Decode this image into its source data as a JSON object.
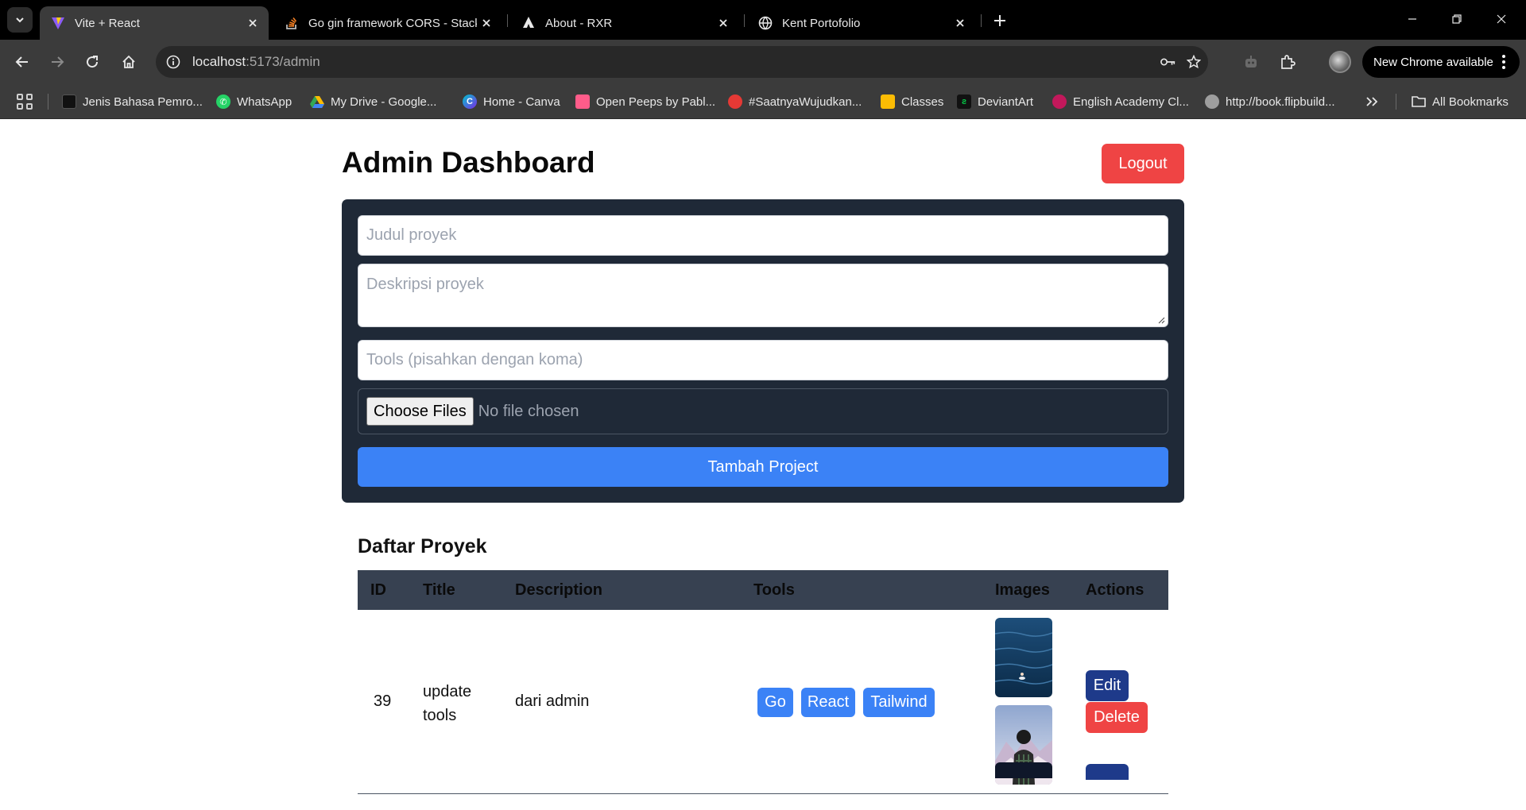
{
  "browser": {
    "tabs": [
      {
        "title": "Vite + React",
        "active": true
      },
      {
        "title": "Go gin framework CORS - Stack",
        "active": false
      },
      {
        "title": "About - RXR",
        "active": false
      },
      {
        "title": "Kent Portofolio",
        "active": false
      }
    ],
    "url": {
      "host": "localhost",
      "path": ":5173/admin"
    },
    "new_chrome_label": "New Chrome available",
    "bookmarks": [
      {
        "label": "Jenis Bahasa Pemro...",
        "color": "#111111"
      },
      {
        "label": "WhatsApp",
        "color": "#25d366"
      },
      {
        "label": "My Drive - Google...",
        "color": "#fbbc04"
      },
      {
        "label": "Home - Canva",
        "color": "#7d2ae8"
      },
      {
        "label": "Open Peeps by Pabl...",
        "color": "#ff5c8a"
      },
      {
        "label": "#SaatnyaWujudkan...",
        "color": "#e53935"
      },
      {
        "label": "Classes",
        "color": "#fbbc04"
      },
      {
        "label": "DeviantArt",
        "color": "#05cc47"
      },
      {
        "label": "English Academy Cl...",
        "color": "#c2185b"
      },
      {
        "label": "http://book.flipbuild...",
        "color": "#9e9e9e"
      }
    ],
    "all_bookmarks_label": "All Bookmarks"
  },
  "header": {
    "title": "Admin Dashboard",
    "logout_label": "Logout"
  },
  "form": {
    "title_placeholder": "Judul proyek",
    "description_placeholder": "Deskripsi proyek",
    "tools_placeholder": "Tools (pisahkan dengan koma)",
    "choose_files_label": "Choose Files",
    "no_file_label": "No file chosen",
    "submit_label": "Tambah Project"
  },
  "projects": {
    "title": "Daftar Proyek",
    "columns": [
      "ID",
      "Title",
      "Description",
      "Tools",
      "Images",
      "Actions"
    ],
    "rows": [
      {
        "id": "39",
        "title_line1": "update",
        "title_line2": "tools",
        "description": "dari admin",
        "tools": [
          "Go",
          "React",
          "Tailwind"
        ],
        "images": [
          "ocean-swimmer",
          "person-snow-mountain"
        ],
        "edit_label": "Edit",
        "delete_label": "Delete"
      }
    ]
  },
  "colors": {
    "accent_blue": "#3b82f6",
    "danger_red": "#ef4444",
    "edit_navy": "#1e3a8a",
    "card_dark": "#1f2937",
    "table_header": "#374151"
  }
}
